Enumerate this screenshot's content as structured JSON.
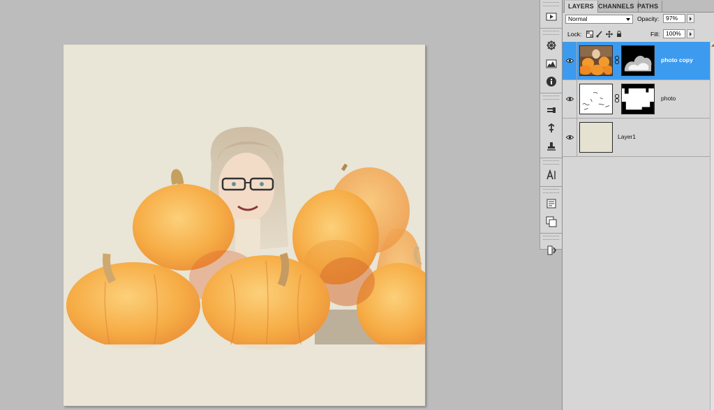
{
  "layers_panel": {
    "tabs": [
      {
        "label": "LAYERS"
      },
      {
        "label": "CHANNELS"
      },
      {
        "label": "PATHS"
      }
    ],
    "blend_mode": "Normal",
    "opacity_label": "Opacity:",
    "opacity_value": "97%",
    "lock_label": "Lock:",
    "fill_label": "Fill:",
    "fill_value": "100%",
    "layers": [
      {
        "name": "photo copy",
        "selected": true,
        "visible": true
      },
      {
        "name": "photo",
        "selected": false,
        "visible": true
      },
      {
        "name": "Layer1",
        "selected": false,
        "visible": true
      }
    ]
  },
  "dock_icons": [
    "play-actions-icon",
    "navigator-icon",
    "histogram-icon",
    "info-icon",
    "brush-presets-icon",
    "clone-source-icon",
    "tool-presets-icon",
    "character-icon",
    "notes-icon",
    "layer-comps-icon",
    "history-icon"
  ],
  "colors": {
    "workspace": "#bcbcbc",
    "panel": "#d6d6d6",
    "selected_layer": "#3d9bef",
    "canvas_paper": "#e9e5d7",
    "pumpkin": "#f3a845"
  }
}
